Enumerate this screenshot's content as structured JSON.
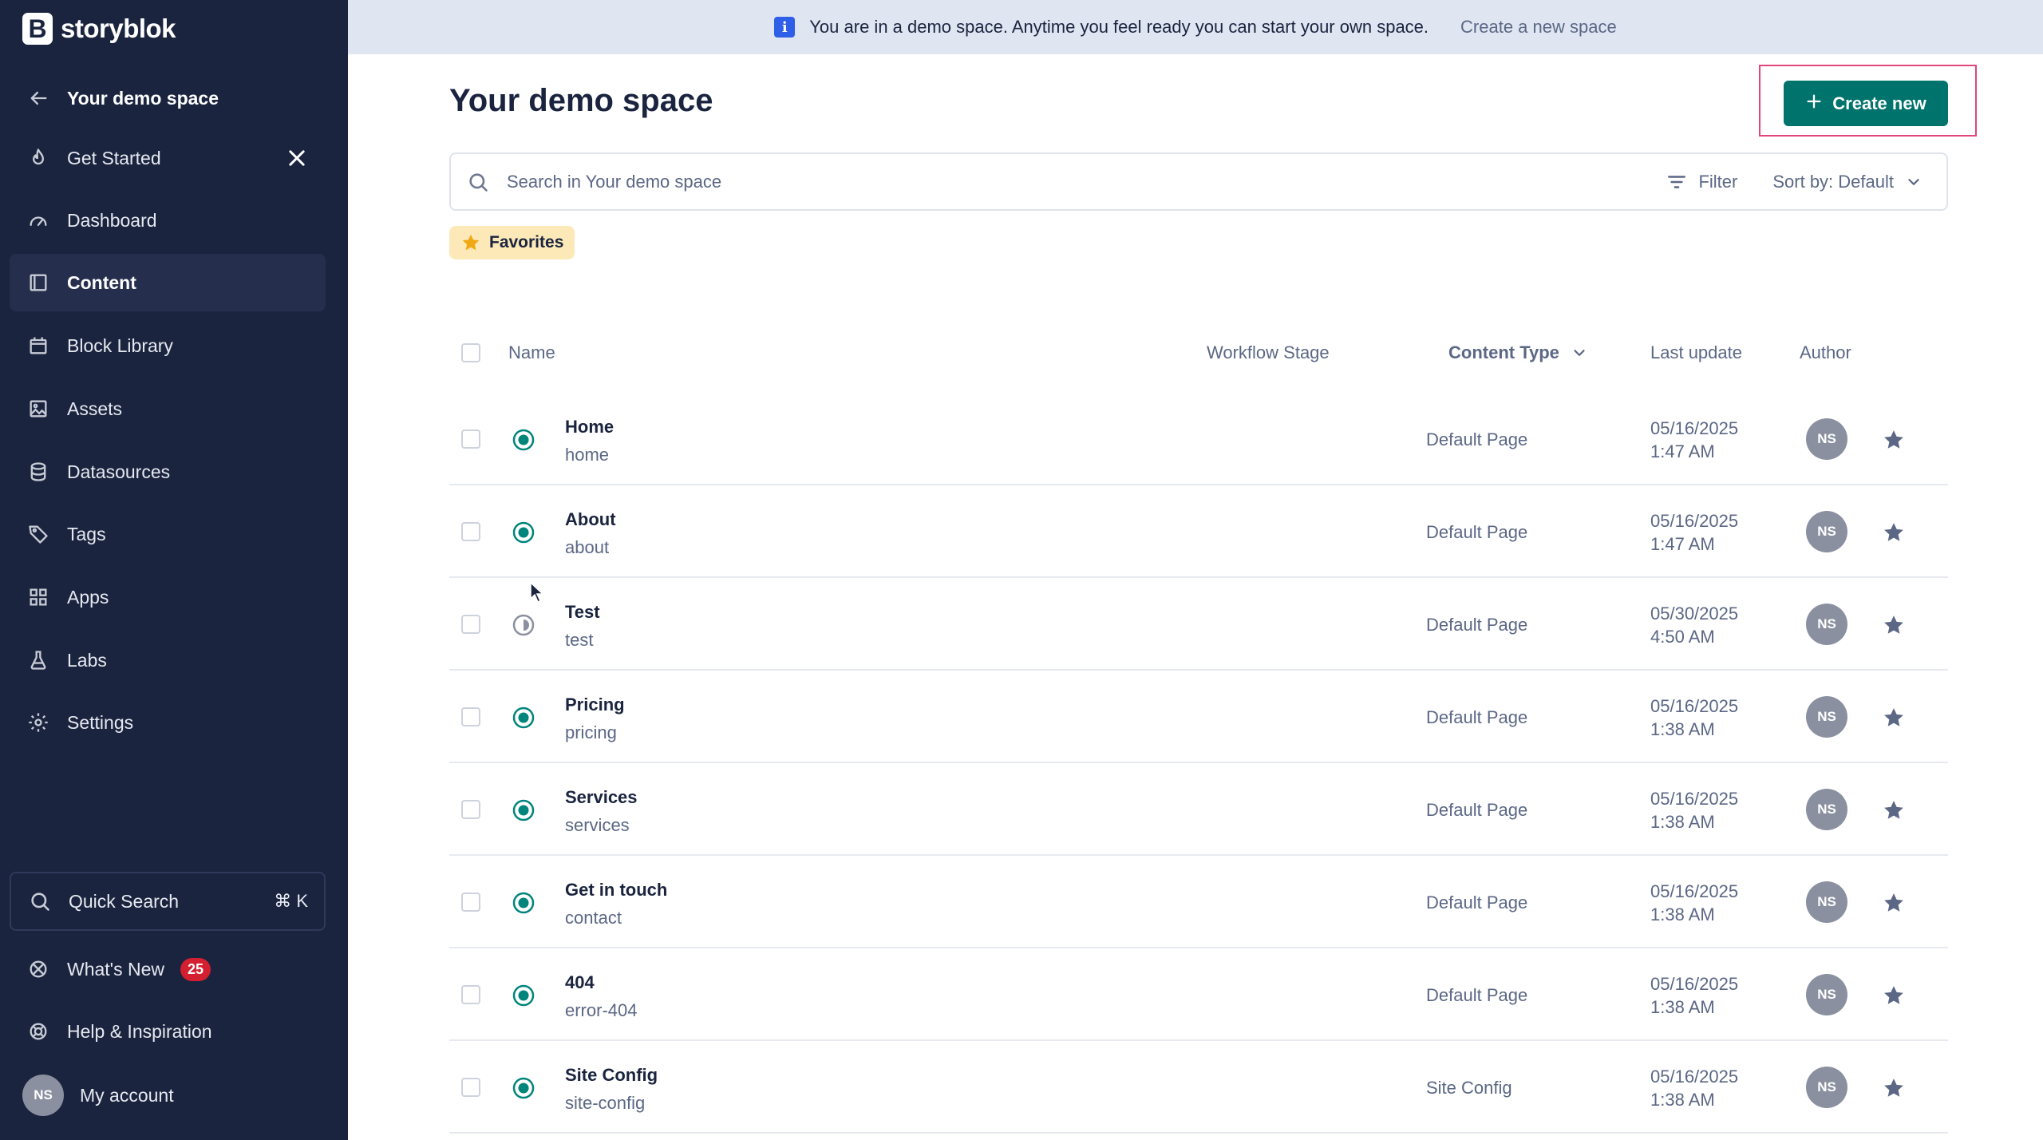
{
  "brand": {
    "name": "storyblok"
  },
  "sidebar": {
    "back_label": "Your demo space",
    "items": [
      {
        "label": "Get Started",
        "icon": "flame-icon"
      },
      {
        "label": "Dashboard",
        "icon": "gauge-icon"
      },
      {
        "label": "Content",
        "icon": "content-icon",
        "active": true
      },
      {
        "label": "Block Library",
        "icon": "block-library-icon"
      },
      {
        "label": "Assets",
        "icon": "image-icon"
      },
      {
        "label": "Datasources",
        "icon": "database-icon"
      },
      {
        "label": "Tags",
        "icon": "tag-icon"
      },
      {
        "label": "Apps",
        "icon": "grid-icon"
      },
      {
        "label": "Labs",
        "icon": "flask-icon"
      },
      {
        "label": "Settings",
        "icon": "gear-icon"
      }
    ],
    "quick_search": {
      "label": "Quick Search",
      "shortcut": "⌘ K"
    },
    "whats_new": {
      "label": "What's New",
      "count": "25"
    },
    "help": {
      "label": "Help & Inspiration"
    },
    "account": {
      "label": "My account",
      "initials": "NS"
    }
  },
  "banner": {
    "message": "You are in a demo space. Anytime you feel ready you can start your own space.",
    "link": "Create a new space"
  },
  "main": {
    "title": "Your demo space",
    "create_button": "Create new",
    "search_placeholder": "Search in Your demo space",
    "filter_label": "Filter",
    "sort_label": "Sort by: Default",
    "favorites_label": "Favorites",
    "columns": {
      "name": "Name",
      "workflow": "Workflow Stage",
      "content_type": "Content Type",
      "last_update": "Last update",
      "author": "Author"
    },
    "rows": [
      {
        "name": "Home",
        "slug": "home",
        "type": "Default Page",
        "date": "05/16/2025",
        "time": "1:47 AM",
        "author": "NS",
        "status": "published"
      },
      {
        "name": "About",
        "slug": "about",
        "type": "Default Page",
        "date": "05/16/2025",
        "time": "1:47 AM",
        "author": "NS",
        "status": "published"
      },
      {
        "name": "Test",
        "slug": "test",
        "type": "Default Page",
        "date": "05/30/2025",
        "time": "4:50 AM",
        "author": "NS",
        "status": "draft"
      },
      {
        "name": "Pricing",
        "slug": "pricing",
        "type": "Default Page",
        "date": "05/16/2025",
        "time": "1:38 AM",
        "author": "NS",
        "status": "published"
      },
      {
        "name": "Services",
        "slug": "services",
        "type": "Default Page",
        "date": "05/16/2025",
        "time": "1:38 AM",
        "author": "NS",
        "status": "published"
      },
      {
        "name": "Get in touch",
        "slug": "contact",
        "type": "Default Page",
        "date": "05/16/2025",
        "time": "1:38 AM",
        "author": "NS",
        "status": "published"
      },
      {
        "name": "404",
        "slug": "error-404",
        "type": "Default Page",
        "date": "05/16/2025",
        "time": "1:38 AM",
        "author": "NS",
        "status": "published"
      },
      {
        "name": "Site Config",
        "slug": "site-config",
        "type": "Site Config",
        "date": "05/16/2025",
        "time": "1:38 AM",
        "author": "NS",
        "status": "published"
      }
    ]
  },
  "colors": {
    "sidebar_bg": "#1b243f",
    "primary": "#00736c",
    "banner_bg": "#dfe6f2",
    "badge_red": "#d31f2f",
    "favorites_bg": "#fde9b8",
    "highlight": "#e0457b"
  }
}
